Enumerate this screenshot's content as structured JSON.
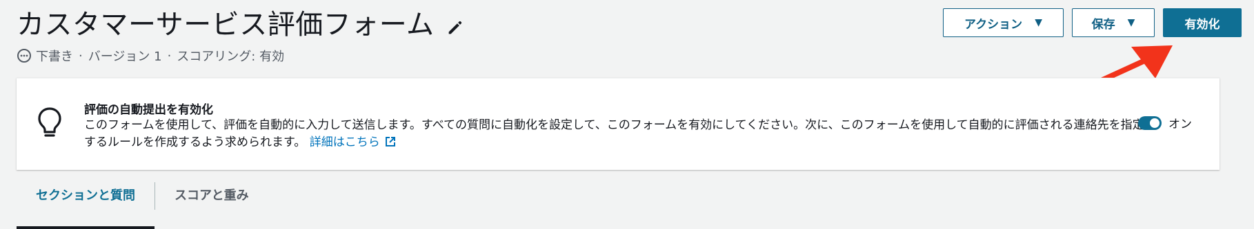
{
  "header": {
    "title": "カスタマーサービス評価フォーム",
    "meta": {
      "status": "下書き",
      "version": "バージョン 1",
      "scoring": "スコアリング: 有効",
      "separator": "·"
    }
  },
  "actions": {
    "action_label": "アクション",
    "save_label": "保存",
    "enable_label": "有効化"
  },
  "auto_submit_card": {
    "title": "評価の自動提出を有効化",
    "description": "このフォームを使用して、評価を自動的に入力して送信します。すべての質問に自動化を設定して、このフォームを有効にしてください。次に、このフォームを使用して自動的に評価される連絡先を指定するルールを作成するよう求められます。",
    "link_label": "詳細はこちら",
    "toggle": {
      "state": true,
      "label": "オン"
    }
  },
  "tabs": [
    {
      "label": "セクションと質問",
      "active": true
    },
    {
      "label": "スコアと重み",
      "active": false
    }
  ],
  "colors": {
    "primary": "#0f6f94",
    "link": "#0073bb",
    "annotation_arrow": "#f2331b"
  },
  "icons": {
    "edit": "pencil-icon",
    "status": "draft-status-icon",
    "bulb": "lightbulb-icon",
    "external": "external-link-icon",
    "caret": "caret-down-icon"
  }
}
